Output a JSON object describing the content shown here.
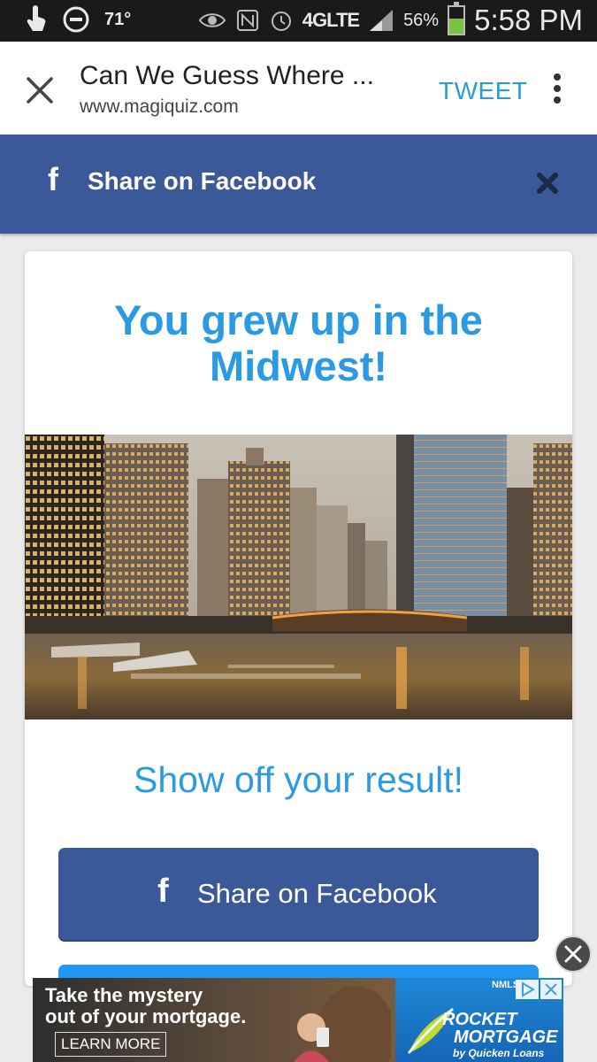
{
  "status_bar": {
    "temperature": "71°",
    "network": "4GLTE",
    "battery_percent": "56%",
    "battery_level": 0.56,
    "time": "5:58 PM"
  },
  "browser": {
    "page_title": "Can We Guess Where ...",
    "url": "www.magiquiz.com",
    "tweet_label": "TWEET"
  },
  "share_banner": {
    "label": "Share on Facebook"
  },
  "result": {
    "title": "You grew up in the Midwest!",
    "show_off": "Show off your result!",
    "fb_button_label": "Share on Facebook"
  },
  "ad": {
    "headline_line1": "Take the mystery",
    "headline_line2": "out of your mortgage.",
    "cta": "LEARN MORE",
    "nmls": "NMLS",
    "brand_line1": "ROCKET",
    "brand_line2": "MORTGAGE",
    "brand_line3": "by Quicken Loans"
  },
  "colors": {
    "facebook_blue": "#3b5998",
    "accent_blue": "#2b9ae4",
    "tweet_blue": "#2b9ad8"
  }
}
